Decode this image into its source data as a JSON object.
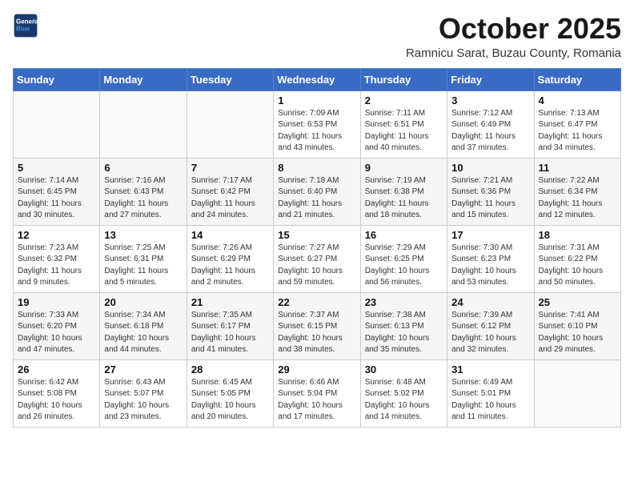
{
  "header": {
    "logo_line1": "General",
    "logo_line2": "Blue",
    "month": "October 2025",
    "location": "Ramnicu Sarat, Buzau County, Romania"
  },
  "weekdays": [
    "Sunday",
    "Monday",
    "Tuesday",
    "Wednesday",
    "Thursday",
    "Friday",
    "Saturday"
  ],
  "weeks": [
    [
      {
        "day": "",
        "info": ""
      },
      {
        "day": "",
        "info": ""
      },
      {
        "day": "",
        "info": ""
      },
      {
        "day": "1",
        "info": "Sunrise: 7:09 AM\nSunset: 6:53 PM\nDaylight: 11 hours\nand 43 minutes."
      },
      {
        "day": "2",
        "info": "Sunrise: 7:11 AM\nSunset: 6:51 PM\nDaylight: 11 hours\nand 40 minutes."
      },
      {
        "day": "3",
        "info": "Sunrise: 7:12 AM\nSunset: 6:49 PM\nDaylight: 11 hours\nand 37 minutes."
      },
      {
        "day": "4",
        "info": "Sunrise: 7:13 AM\nSunset: 6:47 PM\nDaylight: 11 hours\nand 34 minutes."
      }
    ],
    [
      {
        "day": "5",
        "info": "Sunrise: 7:14 AM\nSunset: 6:45 PM\nDaylight: 11 hours\nand 30 minutes."
      },
      {
        "day": "6",
        "info": "Sunrise: 7:16 AM\nSunset: 6:43 PM\nDaylight: 11 hours\nand 27 minutes."
      },
      {
        "day": "7",
        "info": "Sunrise: 7:17 AM\nSunset: 6:42 PM\nDaylight: 11 hours\nand 24 minutes."
      },
      {
        "day": "8",
        "info": "Sunrise: 7:18 AM\nSunset: 6:40 PM\nDaylight: 11 hours\nand 21 minutes."
      },
      {
        "day": "9",
        "info": "Sunrise: 7:19 AM\nSunset: 6:38 PM\nDaylight: 11 hours\nand 18 minutes."
      },
      {
        "day": "10",
        "info": "Sunrise: 7:21 AM\nSunset: 6:36 PM\nDaylight: 11 hours\nand 15 minutes."
      },
      {
        "day": "11",
        "info": "Sunrise: 7:22 AM\nSunset: 6:34 PM\nDaylight: 11 hours\nand 12 minutes."
      }
    ],
    [
      {
        "day": "12",
        "info": "Sunrise: 7:23 AM\nSunset: 6:32 PM\nDaylight: 11 hours\nand 9 minutes."
      },
      {
        "day": "13",
        "info": "Sunrise: 7:25 AM\nSunset: 6:31 PM\nDaylight: 11 hours\nand 5 minutes."
      },
      {
        "day": "14",
        "info": "Sunrise: 7:26 AM\nSunset: 6:29 PM\nDaylight: 11 hours\nand 2 minutes."
      },
      {
        "day": "15",
        "info": "Sunrise: 7:27 AM\nSunset: 6:27 PM\nDaylight: 10 hours\nand 59 minutes."
      },
      {
        "day": "16",
        "info": "Sunrise: 7:29 AM\nSunset: 6:25 PM\nDaylight: 10 hours\nand 56 minutes."
      },
      {
        "day": "17",
        "info": "Sunrise: 7:30 AM\nSunset: 6:23 PM\nDaylight: 10 hours\nand 53 minutes."
      },
      {
        "day": "18",
        "info": "Sunrise: 7:31 AM\nSunset: 6:22 PM\nDaylight: 10 hours\nand 50 minutes."
      }
    ],
    [
      {
        "day": "19",
        "info": "Sunrise: 7:33 AM\nSunset: 6:20 PM\nDaylight: 10 hours\nand 47 minutes."
      },
      {
        "day": "20",
        "info": "Sunrise: 7:34 AM\nSunset: 6:18 PM\nDaylight: 10 hours\nand 44 minutes."
      },
      {
        "day": "21",
        "info": "Sunrise: 7:35 AM\nSunset: 6:17 PM\nDaylight: 10 hours\nand 41 minutes."
      },
      {
        "day": "22",
        "info": "Sunrise: 7:37 AM\nSunset: 6:15 PM\nDaylight: 10 hours\nand 38 minutes."
      },
      {
        "day": "23",
        "info": "Sunrise: 7:38 AM\nSunset: 6:13 PM\nDaylight: 10 hours\nand 35 minutes."
      },
      {
        "day": "24",
        "info": "Sunrise: 7:39 AM\nSunset: 6:12 PM\nDaylight: 10 hours\nand 32 minutes."
      },
      {
        "day": "25",
        "info": "Sunrise: 7:41 AM\nSunset: 6:10 PM\nDaylight: 10 hours\nand 29 minutes."
      }
    ],
    [
      {
        "day": "26",
        "info": "Sunrise: 6:42 AM\nSunset: 5:08 PM\nDaylight: 10 hours\nand 26 minutes."
      },
      {
        "day": "27",
        "info": "Sunrise: 6:43 AM\nSunset: 5:07 PM\nDaylight: 10 hours\nand 23 minutes."
      },
      {
        "day": "28",
        "info": "Sunrise: 6:45 AM\nSunset: 5:05 PM\nDaylight: 10 hours\nand 20 minutes."
      },
      {
        "day": "29",
        "info": "Sunrise: 6:46 AM\nSunset: 5:04 PM\nDaylight: 10 hours\nand 17 minutes."
      },
      {
        "day": "30",
        "info": "Sunrise: 6:48 AM\nSunset: 5:02 PM\nDaylight: 10 hours\nand 14 minutes."
      },
      {
        "day": "31",
        "info": "Sunrise: 6:49 AM\nSunset: 5:01 PM\nDaylight: 10 hours\nand 11 minutes."
      },
      {
        "day": "",
        "info": ""
      }
    ]
  ]
}
